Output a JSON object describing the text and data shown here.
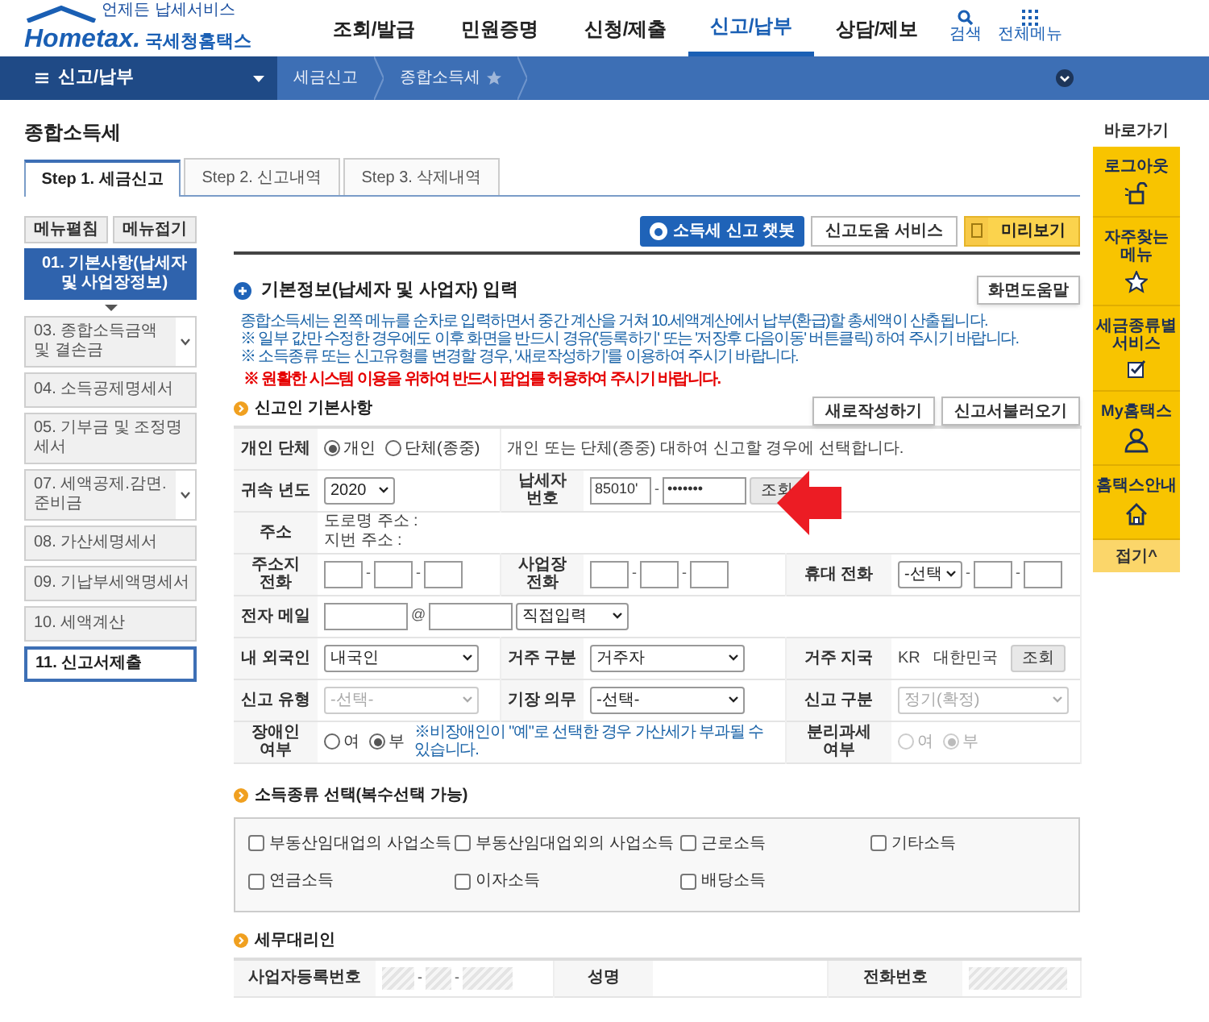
{
  "header": {
    "logo": {
      "tagline": "언제든 납세서비스",
      "brand": "Hometax.",
      "name": "국세청홈택스"
    },
    "nav": [
      {
        "label": "조회/발급",
        "selected": false
      },
      {
        "label": "민원증명",
        "selected": false
      },
      {
        "label": "신청/제출",
        "selected": false
      },
      {
        "label": "신고/납부",
        "selected": true
      },
      {
        "label": "상담/제보",
        "selected": false
      }
    ],
    "utilities": [
      {
        "label": "검색",
        "kind": "search"
      },
      {
        "label": "전체메뉴",
        "kind": "grid"
      }
    ]
  },
  "breadcrumb": {
    "menu": "신고/납부",
    "items": [
      {
        "label": "세금신고",
        "favorite": false
      },
      {
        "label": "종합소득세",
        "favorite": true
      }
    ]
  },
  "page_title": "종합소득세",
  "tabs": [
    {
      "label": "Step 1. 세금신고",
      "selected": true
    },
    {
      "label": "Step 2. 신고내역",
      "selected": false
    },
    {
      "label": "Step 3. 삭제내역",
      "selected": false
    }
  ],
  "sidebar": {
    "buttons": [
      "메뉴펼침",
      "메뉴접기"
    ],
    "items": [
      {
        "label": "01. 기본사항(납세자 및 사업장정보)",
        "selected": true,
        "expandable": false,
        "emphasized": false
      },
      {
        "label": "03. 종합소득금액 및 결손금",
        "selected": false,
        "expandable": true,
        "emphasized": false
      },
      {
        "label": "04. 소득공제명세서",
        "selected": false,
        "expandable": false,
        "emphasized": false
      },
      {
        "label": "05. 기부금 및 조정명세서",
        "selected": false,
        "expandable": false,
        "emphasized": false
      },
      {
        "label": "07. 세액공제.감면.준비금",
        "selected": false,
        "expandable": true,
        "emphasized": false
      },
      {
        "label": "08. 가산세명세서",
        "selected": false,
        "expandable": false,
        "emphasized": false
      },
      {
        "label": "09. 기납부세액명세서",
        "selected": false,
        "expandable": false,
        "emphasized": false
      },
      {
        "label": "10. 세액계산",
        "selected": false,
        "expandable": false,
        "emphasized": false
      },
      {
        "label": "11. 신고서제출",
        "selected": false,
        "expandable": false,
        "emphasized": true
      }
    ]
  },
  "toolbar": [
    {
      "label": "소득세 신고 챗봇",
      "kind": "chatbot"
    },
    {
      "label": "신고도움 서비스",
      "kind": "plain"
    },
    {
      "label": "미리보기",
      "kind": "preview"
    }
  ],
  "section": {
    "title": "기본정보(납세자 및 사업자) 입력",
    "help_button": "화면도움말",
    "notes": [
      {
        "text": "종합소득세는 왼쪽 메뉴를 순차로 입력하면서 중간 계산을 거쳐 10.세액계산에서 납부(환급)할 총세액이 산출됩니다.",
        "kind": "info"
      },
      {
        "text": "※ 일부 값만 수정한 경우에도 이후 화면을 반드시 경유('등록하기' 또는 '저장후 다음이동' 버튼클릭) 하여 주시기 바랍니다.",
        "kind": "info"
      },
      {
        "text": "※ 소득종류 또는 신고유형를 변경할 경우, '새로작성하기'를 이용하여 주시기 바랍니다.",
        "kind": "info"
      },
      {
        "text": "※ 원활한 시스템 이용을 위하여 반드시 팝업를 허용하여 주시기 바랍니다.",
        "kind": "warning"
      }
    ]
  },
  "form": {
    "title": "신고인 기본사항",
    "buttons": [
      "새로작성하기",
      "신고서불러오기"
    ],
    "rows": [
      {
        "pairs": [
          {
            "label": "개인 단체",
            "controls": [
              {
                "kind": "radio",
                "disabled": false,
                "options": [
                  {
                    "label": "개인",
                    "selected": true
                  },
                  {
                    "label": "단체(종중)",
                    "selected": false
                  }
                ]
              }
            ]
          },
          {
            "controls": [
              {
                "kind": "text",
                "text": "개인 또는 단체(종중) 대하여 신고할 경우에 선택합니다."
              }
            ]
          }
        ]
      },
      {
        "pairs": [
          {
            "label": "귀속 년도",
            "controls": [
              {
                "kind": "select",
                "value": "2020",
                "disabled": false
              }
            ]
          },
          {
            "label": "납세자 번호",
            "controls": [
              {
                "kind": "input",
                "value": "85010'",
                "disabled": false
              },
              {
                "kind": "sep",
                "text": "-"
              },
              {
                "kind": "input",
                "value": "•••••••",
                "disabled": false
              },
              {
                "kind": "button",
                "label": "조회"
              }
            ]
          }
        ]
      },
      {
        "pairs": [
          {
            "label": "주소",
            "controls": [
              {
                "kind": "lines",
                "lines": [
                  "도로명 주소 :",
                  "지번 주소 :"
                ]
              }
            ]
          }
        ]
      },
      {
        "pairs": [
          {
            "label": "주소지 전화",
            "controls": [
              {
                "kind": "input",
                "disabled": false
              },
              {
                "kind": "sep",
                "text": "-"
              },
              {
                "kind": "input",
                "disabled": false
              },
              {
                "kind": "sep",
                "text": "-"
              },
              {
                "kind": "input",
                "disabled": false
              }
            ]
          },
          {
            "label": "사업장 전화",
            "controls": [
              {
                "kind": "input",
                "disabled": false
              },
              {
                "kind": "sep",
                "text": "-"
              },
              {
                "kind": "input",
                "disabled": false
              },
              {
                "kind": "sep",
                "text": "-"
              },
              {
                "kind": "input",
                "disabled": false
              }
            ]
          },
          {
            "label": "휴대 전화",
            "controls": [
              {
                "kind": "select",
                "value": "-선택",
                "disabled": false
              },
              {
                "kind": "sep",
                "text": "-"
              },
              {
                "kind": "input",
                "disabled": false
              },
              {
                "kind": "sep",
                "text": "-"
              },
              {
                "kind": "input",
                "disabled": false
              }
            ]
          }
        ]
      },
      {
        "pairs": [
          {
            "label": "전자 메일",
            "controls": [
              {
                "kind": "input",
                "disabled": false
              },
              {
                "kind": "sep",
                "text": "@"
              },
              {
                "kind": "input",
                "disabled": false
              },
              {
                "kind": "select",
                "value": "직접입력",
                "disabled": false
              }
            ]
          }
        ]
      },
      {
        "pairs": [
          {
            "label": "내 외국인",
            "controls": [
              {
                "kind": "select",
                "value": "내국인",
                "disabled": false
              }
            ]
          },
          {
            "label": "거주 구분",
            "controls": [
              {
                "kind": "select",
                "value": "거주자",
                "disabled": false
              }
            ]
          },
          {
            "label": "거주 지국",
            "controls": [
              {
                "kind": "text",
                "text": "KR"
              },
              {
                "kind": "text",
                "text": "대한민국"
              },
              {
                "kind": "button",
                "label": "조회"
              }
            ]
          }
        ]
      },
      {
        "pairs": [
          {
            "label": "신고 유형",
            "controls": [
              {
                "kind": "select",
                "value": "-선택-",
                "disabled": true
              }
            ]
          },
          {
            "label": "기장 의무",
            "controls": [
              {
                "kind": "select",
                "value": "-선택-",
                "disabled": false
              }
            ]
          },
          {
            "label": "신고 구분",
            "controls": [
              {
                "kind": "select",
                "value": "정기(확정)",
                "disabled": true
              }
            ]
          }
        ]
      },
      {
        "pairs": [
          {
            "label": "장애인 여부",
            "controls": [
              {
                "kind": "radio",
                "disabled": false,
                "options": [
                  {
                    "label": "여",
                    "selected": false
                  },
                  {
                    "label": "부",
                    "selected": true
                  }
                ]
              },
              {
                "kind": "note",
                "text": "※비장애인이 \"예\"로 선택한 경우 가산세가 부과될 수 있습니다."
              }
            ]
          },
          {
            "label": "분리과세 여부",
            "controls": [
              {
                "kind": "radio",
                "disabled": true,
                "options": [
                  {
                    "label": "여",
                    "selected": false
                  },
                  {
                    "label": "부",
                    "selected": true
                  }
                ]
              }
            ]
          }
        ]
      }
    ]
  },
  "income_types": {
    "title": "소득종류 선택(복수선택 가능)",
    "options": [
      {
        "label": "부동산임대업의 사업소득",
        "checked": false
      },
      {
        "label": "부동산임대업외의 사업소득",
        "checked": false
      },
      {
        "label": "근로소득",
        "checked": false
      },
      {
        "label": "기타소득",
        "checked": false
      },
      {
        "label": "연금소득",
        "checked": false
      },
      {
        "label": "이자소득",
        "checked": false
      },
      {
        "label": "배당소득",
        "checked": false
      }
    ]
  },
  "tax_agent": {
    "title": "세무대리인",
    "rows": [
      {
        "pairs": [
          {
            "label": "사업자등록번호",
            "controls": [
              {
                "kind": "input",
                "disabled": true
              },
              {
                "kind": "sep",
                "text": "-"
              },
              {
                "kind": "input",
                "disabled": true
              },
              {
                "kind": "sep",
                "text": "-"
              },
              {
                "kind": "input",
                "disabled": true
              }
            ]
          },
          {
            "label": "성명"
          },
          {
            "label": "전화번호",
            "controls": [
              {
                "kind": "input",
                "disabled": true
              }
            ]
          }
        ]
      }
    ]
  },
  "quick_bar": {
    "title": "바로가기",
    "items": [
      {
        "label": "로그아웃"
      },
      {
        "label": "자주찾는 메뉴"
      },
      {
        "label": "세금종류별 서비스"
      },
      {
        "label": "My홈택스"
      },
      {
        "label": "홈택스안내"
      }
    ],
    "collapse": "접기^"
  }
}
